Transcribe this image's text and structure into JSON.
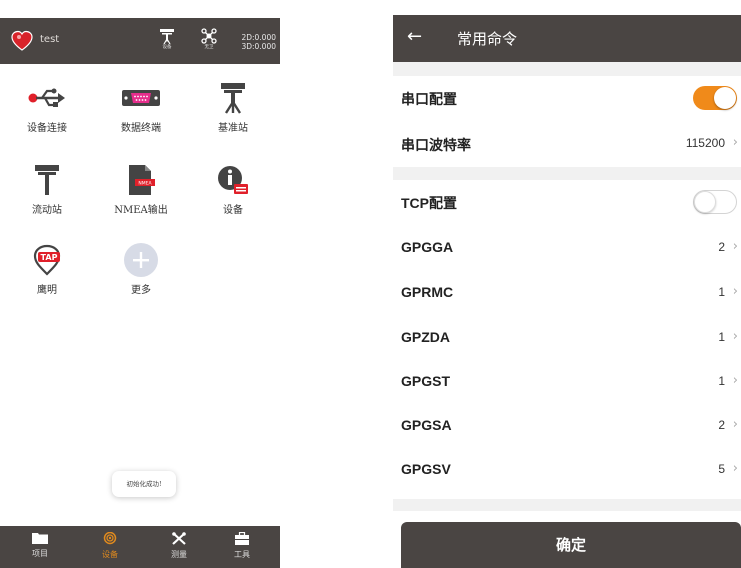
{
  "left_screen": {
    "top_bar": {
      "project_name": "test",
      "device_icon_caption": "设备",
      "satellite_icon_caption": "无卫",
      "coord_2d": "2D:0.000",
      "coord_3d": "3D:0.000"
    },
    "grid": [
      {
        "label": "设备连接",
        "icon": "usb-icon"
      },
      {
        "label": "数据终端",
        "icon": "serial-port-icon"
      },
      {
        "label": "基准站",
        "icon": "base-station-icon"
      },
      {
        "label": "流动站",
        "icon": "rover-icon"
      },
      {
        "label": "NMEA输出",
        "icon": "nmea-file-icon"
      },
      {
        "label": "设备",
        "icon": "device-info-icon"
      },
      {
        "label": "鹰明",
        "icon": "tap-icon"
      },
      {
        "label": "更多",
        "icon": "plus-icon"
      }
    ],
    "toast": "初始化成功!",
    "bottom_nav": [
      {
        "label": "项目",
        "icon": "folder-icon"
      },
      {
        "label": "设备",
        "icon": "signal-icon",
        "active": true
      },
      {
        "label": "测量",
        "icon": "survey-tools-icon"
      },
      {
        "label": "工具",
        "icon": "toolbox-icon"
      }
    ],
    "colors": {
      "bar": "#4a4543",
      "accent": "#e08a1e"
    }
  },
  "right_screen": {
    "header": {
      "title": "常用命令",
      "back_icon": "arrow-left-icon"
    },
    "serial_config_label": "串口配置",
    "serial_config_on": true,
    "baud_label": "串口波特率",
    "baud_value": "115200",
    "tcp_config_label": "TCP配置",
    "tcp_config_on": false,
    "messages": [
      {
        "name": "GPGGA",
        "value": "2"
      },
      {
        "name": "GPRMC",
        "value": "1"
      },
      {
        "name": "GPZDA",
        "value": "1"
      },
      {
        "name": "GPGST",
        "value": "1"
      },
      {
        "name": "GPGSA",
        "value": "2"
      },
      {
        "name": "GPGSV",
        "value": "5"
      }
    ],
    "chevron": "›",
    "confirm_label": "确定",
    "colors": {
      "toggle_on": "#f08a1a",
      "header": "#4a4543"
    }
  }
}
